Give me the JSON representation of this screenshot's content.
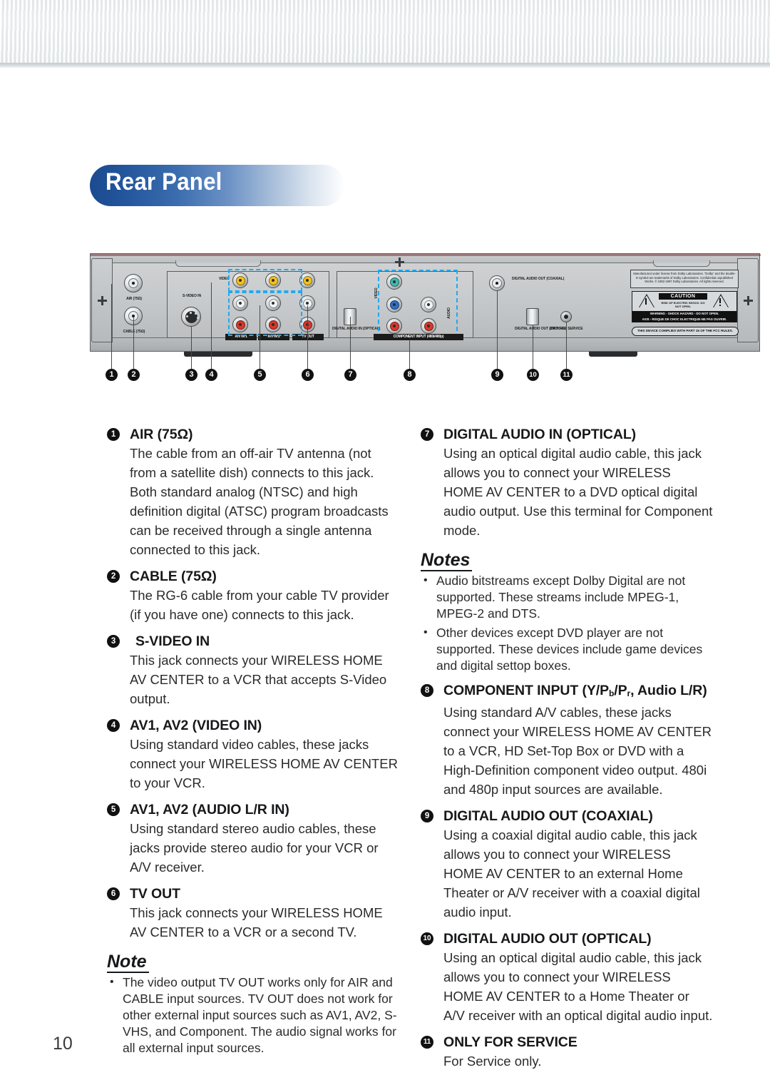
{
  "page": {
    "title": "Rear Panel",
    "number": "10"
  },
  "diagram": {
    "name": "rear-panel-illustration",
    "jack_labels": {
      "air": "AIR (75Ω)",
      "cable": "CABLE (75Ω)",
      "svideo": "S-VIDEO IN",
      "video": "VIDEO",
      "avin1": "A/V IN 1",
      "avin2": "A/V IN 2",
      "tvout": "TV OUT",
      "digital_audio_in_optical": "DIGITAL AUDIO IN (OPTICAL)",
      "component_input": "COMPONENT INPUT (480i/480p)",
      "component_video_side": "VIDEO",
      "component_audio_side": "AUDIO",
      "digital_audio_out_coaxial": "DIGITAL AUDIO OUT (COAXIAL)",
      "digital_audio_out_optical": "DIGITAL AUDIO OUT (OPTICAL)",
      "only_for_service": "ONLY FOR SERVICE"
    },
    "callouts": [
      "1",
      "2",
      "3",
      "4",
      "5",
      "6",
      "7",
      "8",
      "9",
      "10",
      "11"
    ],
    "warning_label": {
      "dolby": "Manufactured under license from Dolby Laboratories. “Dolby” and the double-D symbol are trademarks of Dolby Laboratories. Confidential unpublished Works. © 1992-1997 Dolby Laboratories. All rights reserved.",
      "caution_word": "CAUTION",
      "caution_sub": "RISK OF ELECTRIC SHOCK. DO NOT OPEN.",
      "warning_line1": "WARNING - SHOCK HAZARD - DO NOT OPEN.",
      "warning_line2": "AVIS - RISQUE DE CHOC ELECTRIQUE-NE PAS OUVRIR.",
      "fcc": "THIS DEVICE COMPLIES WITH PART 15 OF THE FCC RULES."
    },
    "highlight_color": "#22a9f0"
  },
  "left_column": {
    "entries": [
      {
        "num": "1",
        "heading": "AIR (75Ω)",
        "body": "The cable from an off-air TV antenna (not from a satellite dish) connects to this jack. Both standard analog (NTSC) and high definition digital (ATSC) program broadcasts can be received through a single antenna connected to this jack."
      },
      {
        "num": "2",
        "heading": "CABLE (75Ω)",
        "body": "The RG-6 cable from your cable TV provider (if you have one) connects to this jack."
      },
      {
        "num": "3",
        "heading": "S-VIDEO IN",
        "body": "This jack connects your WIRELESS HOME AV CENTER to a VCR that accepts S-Video output."
      },
      {
        "num": "4",
        "heading": "AV1, AV2 (VIDEO IN)",
        "body": "Using standard video cables, these jacks connect your WIRELESS HOME AV CENTER to your VCR."
      },
      {
        "num": "5",
        "heading": "AV1, AV2 (AUDIO L/R IN)",
        "body": "Using standard stereo audio cables, these jacks provide stereo audio for your VCR or A/V receiver."
      },
      {
        "num": "6",
        "heading": "TV OUT",
        "body": "This jack connects your WIRELESS HOME AV CENTER to a VCR or a second TV."
      }
    ],
    "note": {
      "title": "Note",
      "items": [
        "The video output TV OUT works only for AIR and CABLE input sources. TV OUT does not work for other external input sources such as AV1, AV2, S-VHS, and Component. The audio signal works for all external input sources."
      ]
    }
  },
  "right_column": {
    "entry7": {
      "num": "7",
      "heading": "DIGITAL AUDIO IN (OPTICAL)",
      "body": "Using an optical digital audio cable, this jack allows you to connect your WIRELESS HOME AV CENTER to a DVD optical digital audio output. Use this terminal for Component mode."
    },
    "notes": {
      "title": "Notes",
      "items": [
        "Audio bitstreams except Dolby Digital are not supported. These streams include MPEG-1, MPEG-2 and DTS.",
        "Other devices except DVD player are not supported. These devices include game devices and digital settop boxes."
      ]
    },
    "entries": [
      {
        "num": "8",
        "heading_html": "COMPONENT INPUT (Y/P<sub>b</sub>/P<sub>r</sub>, Audio L/R)",
        "heading": "COMPONENT INPUT (Y/Pb/Pr, Audio L/R)",
        "body": "Using standard A/V cables, these jacks connect your WIRELESS HOME AV CENTER to a VCR, HD Set-Top Box or DVD with a High-Definition component video output. 480i and 480p input sources are available."
      },
      {
        "num": "9",
        "heading": "DIGITAL AUDIO OUT (COAXIAL)",
        "body": "Using a coaxial digital audio cable, this jack allows you to connect your WIRELESS HOME AV CENTER to an external Home Theater or A/V receiver with a coaxial digital audio input."
      },
      {
        "num": "10",
        "heading": "DIGITAL AUDIO OUT (OPTICAL)",
        "body": "Using an optical digital audio cable, this jack allows you to connect your WIRELESS HOME AV CENTER to a Home Theater or A/V receiver with an optical digital audio input."
      },
      {
        "num": "11",
        "heading": "ONLY FOR SERVICE",
        "body": "For Service only."
      }
    ]
  }
}
